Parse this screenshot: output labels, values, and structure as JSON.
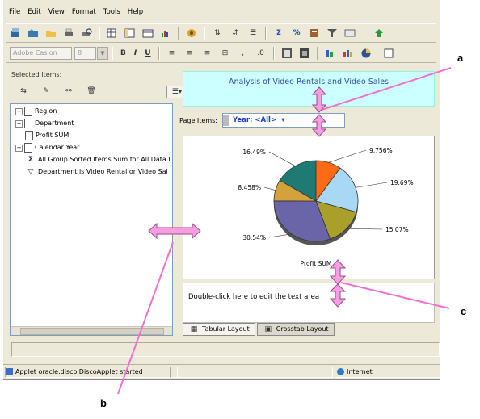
{
  "menu": [
    "File",
    "Edit",
    "View",
    "Format",
    "Tools",
    "Help"
  ],
  "format_toolbar": {
    "font_value": "Adobe Caslon",
    "size_value": "8",
    "bold": "B",
    "italic": "I",
    "underline": "U"
  },
  "left_panel": {
    "title": "Selected Items:",
    "tree": [
      "Region",
      "Department",
      "Profit SUM",
      "Calendar Year",
      "All Group Sorted Items Sum for All Data I",
      "Department is Video Rental or Video Sal"
    ]
  },
  "report": {
    "title": "Analysis of Video Rentals and Video Sales",
    "page_items_label": "Page Items:",
    "page_item_value": "Year: <All>",
    "text_area_hint": "Double-click here to edit the text area",
    "tabs": [
      "Tabular Layout",
      "Crosstab Layout"
    ]
  },
  "chart_data": {
    "type": "pie",
    "title": "",
    "xlabel": "Profit SUM",
    "slices": [
      {
        "label": "16.49%",
        "value": 16.49,
        "color": "#1f7a74"
      },
      {
        "label": "9.756%",
        "value": 9.756,
        "color": "#ff6a14"
      },
      {
        "label": "19.69%",
        "value": 19.69,
        "color": "#a8d8f4"
      },
      {
        "label": "15.07%",
        "value": 15.07,
        "color": "#a9a02c"
      },
      {
        "label": "30.54%",
        "value": 30.54,
        "color": "#6a65a8"
      },
      {
        "label": "8.458%",
        "value": 8.458,
        "color": "#d4a23a"
      }
    ]
  },
  "status": {
    "applet": "Applet oracle.disco.DiscoApplet started",
    "zone": "Internet"
  },
  "callouts": [
    "a",
    "b",
    "c"
  ],
  "colors": {
    "callout_line": "#f070d0",
    "arrow_fill": "#f59ee0",
    "title_bg": "#ccffff",
    "title_text": "#3050a0"
  }
}
